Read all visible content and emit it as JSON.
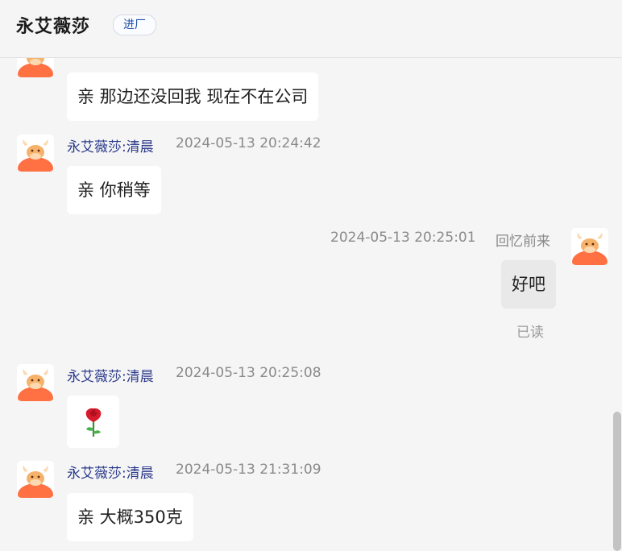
{
  "header": {
    "title": "永艾薇莎",
    "tag": "进厂"
  },
  "messages": [
    {
      "type": "incoming",
      "text": "亲 那边还没回我 现在不在公司"
    },
    {
      "type": "incoming",
      "sender": "永艾薇莎:清晨",
      "time": "2024-05-13 20:24:42",
      "text": "亲 你稍等"
    },
    {
      "type": "outgoing",
      "sender": "回忆前来",
      "time": "2024-05-13 20:25:01",
      "text": "好吧",
      "status": "已读"
    },
    {
      "type": "incoming",
      "sender": "永艾薇莎:清晨",
      "time": "2024-05-13 20:25:08",
      "emoji": "rose-icon"
    },
    {
      "type": "incoming",
      "sender": "永艾薇莎:清晨",
      "time": "2024-05-13 21:31:09",
      "text": "亲 大概350克"
    }
  ],
  "colors": {
    "background": "#f5f5f6",
    "sender_name": "#2b3a8a",
    "avatar_orange": "#ff7043",
    "tag_text": "#1f4fa8"
  }
}
